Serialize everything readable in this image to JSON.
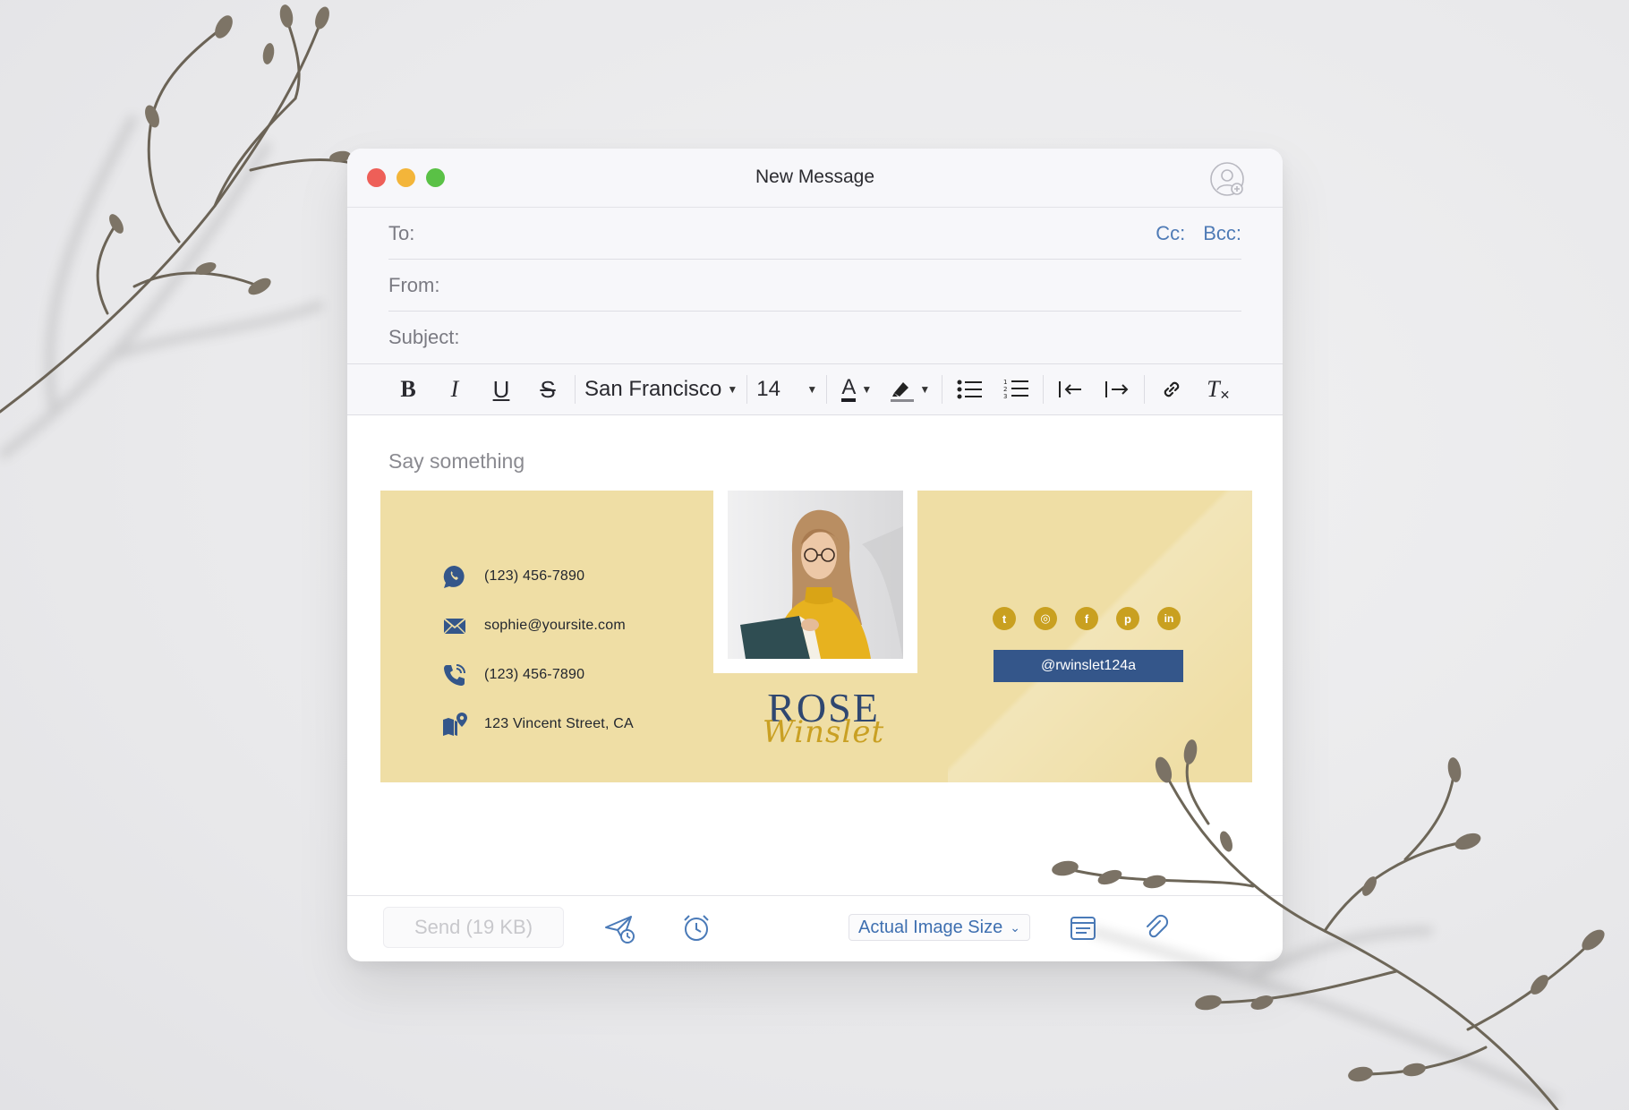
{
  "window": {
    "title": "New Message",
    "traffic_lights": [
      "#ee5f58",
      "#f3b53a",
      "#5ac146"
    ],
    "contact_icon": "add-contact-icon"
  },
  "headers": {
    "to_label": "To:",
    "cc_label": "Cc:",
    "bcc_label": "Bcc:",
    "from_label": "From:",
    "subject_label": "Subject:"
  },
  "toolbar": {
    "bold": "B",
    "italic": "I",
    "underline": "U",
    "strike": "S",
    "font": "San Francisco",
    "size": "14",
    "text_color": "A",
    "clear_format": "T",
    "icons": [
      "bold-icon",
      "italic-icon",
      "underline-icon",
      "strikethrough-icon",
      "text-color-icon",
      "highlight-icon",
      "bullet-list-icon",
      "numbered-list-icon",
      "outdent-icon",
      "indent-icon",
      "link-icon",
      "clear-format-icon"
    ]
  },
  "body": {
    "placeholder": "Say something"
  },
  "signature": {
    "background": "#efdea5",
    "contacts": [
      {
        "icon": "whatsapp-icon",
        "text": "(123) 456-7890"
      },
      {
        "icon": "mail-icon",
        "text": "sophie@yoursite.com"
      },
      {
        "icon": "phone-icon",
        "text": "(123) 456-7890"
      },
      {
        "icon": "map-pin-icon",
        "text": "123 Vincent Street, CA"
      }
    ],
    "first_name": "ROSE",
    "last_name": "Winslet",
    "social": [
      {
        "icon": "twitter-icon",
        "glyph": "t"
      },
      {
        "icon": "instagram-icon",
        "glyph": "◎"
      },
      {
        "icon": "facebook-icon",
        "glyph": "f"
      },
      {
        "icon": "pinterest-icon",
        "glyph": "p"
      },
      {
        "icon": "linkedin-icon",
        "glyph": "in"
      }
    ],
    "handle": "@rwinslet124a",
    "accent_gold": "#c9a020",
    "accent_navy": "#34568a"
  },
  "bottombar": {
    "send_label": "Send (19 KB)",
    "image_size_label": "Actual Image Size",
    "icons": [
      "send-later-icon",
      "reminder-clock-icon",
      "template-icon",
      "attachment-icon"
    ]
  }
}
